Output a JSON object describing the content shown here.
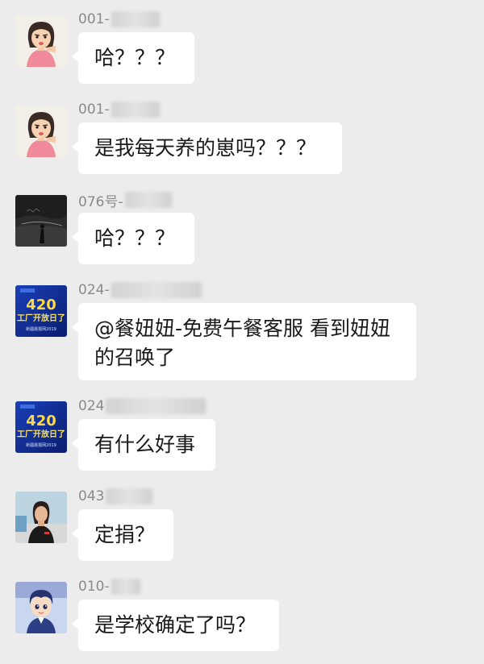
{
  "chat": {
    "messages": [
      {
        "sender": "001-",
        "avatar": "girl-avatar-icon",
        "text": "哈？？？"
      },
      {
        "sender": "001-",
        "avatar": "girl-avatar-icon",
        "text": "是我每天养的崽吗？？？"
      },
      {
        "sender": "076号-",
        "avatar": "dark-landscape-avatar-icon",
        "text": "哈？？？"
      },
      {
        "sender": "024-",
        "avatar": "event-420-poster-avatar-icon",
        "text": "@餐妞妞-免费午餐客服 看到妞妞\n的召唤了"
      },
      {
        "sender": "024",
        "avatar": "event-420-poster-avatar-icon",
        "text": "有什么好事"
      },
      {
        "sender": "043",
        "avatar": "woman-photo-avatar-icon",
        "text": "定捐？"
      },
      {
        "sender": "010-",
        "avatar": "cartoon-boy-avatar-icon",
        "text": "是学校确定了吗？"
      }
    ]
  },
  "avatar_text": {
    "poster_big": "420",
    "poster_sub": "工厂开放日了",
    "poster_small": "新疆晨报网2019"
  },
  "colors": {
    "background": "#ececec",
    "bubble": "#ffffff",
    "sender_name": "#8a8a8a",
    "text": "#1a1a1a"
  }
}
